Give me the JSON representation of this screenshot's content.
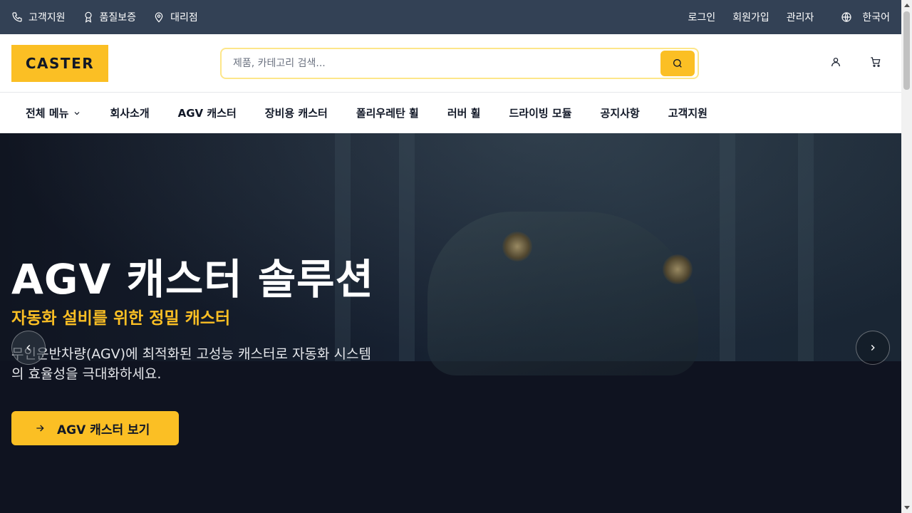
{
  "topbar": {
    "left": [
      {
        "label": "고객지원",
        "icon": "phone-icon"
      },
      {
        "label": "품질보증",
        "icon": "award-icon"
      },
      {
        "label": "대리점",
        "icon": "map-pin-icon"
      }
    ],
    "right": [
      {
        "label": "로그인"
      },
      {
        "label": "회원가입"
      },
      {
        "label": "관리자"
      }
    ],
    "language": {
      "label": "한국어",
      "icon": "globe-icon"
    }
  },
  "header": {
    "logo": "CASTER",
    "search_placeholder": "제품, 카테고리 검색...",
    "icons": [
      "user-icon",
      "cart-icon"
    ]
  },
  "nav": {
    "all_menu": "전체 메뉴",
    "items": [
      "회사소개",
      "AGV 캐스터",
      "장비용 캐스터",
      "폴리우레탄 휠",
      "러버 휠",
      "드라이빙 모듈",
      "공지사항",
      "고객지원"
    ]
  },
  "hero": {
    "title": "AGV 캐스터 솔루션",
    "subtitle": "자동화 설비를 위한 정밀 캐스터",
    "description": "무인운반차량(AGV)에 최적화된 고성능 캐스터로 자동화 시스템의 효율성을 극대화하세요.",
    "cta": "AGV 캐스터 보기"
  },
  "colors": {
    "accent": "#fbbf24",
    "topbar": "#334155",
    "hero_bg": "#111827"
  }
}
